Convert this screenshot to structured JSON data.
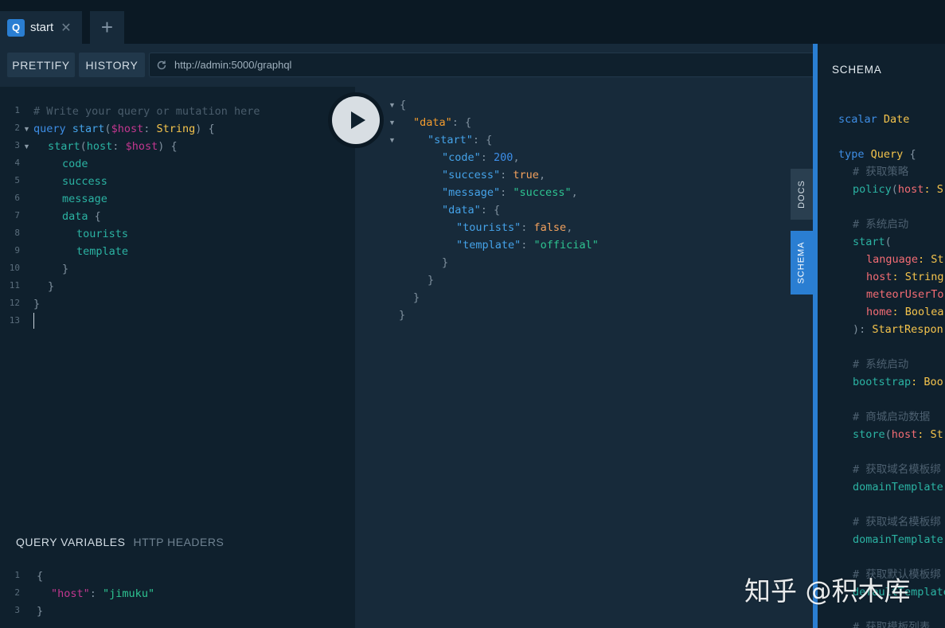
{
  "tabs": [
    {
      "badge": "Q",
      "label": "start",
      "close": "✕"
    }
  ],
  "new_tab": "+",
  "toolbar": {
    "prettify": "PRETTIFY",
    "history": "HISTORY",
    "url": "http://admin:5000/graphql"
  },
  "editor": {
    "line_numbers": [
      "1",
      "2",
      "3",
      "4",
      "5",
      "6",
      "7",
      "8",
      "9",
      "10",
      "11",
      "12",
      "13"
    ],
    "comment": "# Write your query or mutation here",
    "query_kw": "query",
    "op_name": "start",
    "var": "$host",
    "type": "String",
    "field_start": "start",
    "arg_host": "host",
    "fields": [
      "code",
      "success",
      "message",
      "data"
    ],
    "sub_fields": [
      "tourists",
      "template"
    ]
  },
  "variables": {
    "title": "QUERY VARIABLES",
    "headers_tab": "HTTP HEADERS",
    "line_numbers": [
      "1",
      "2",
      "3"
    ],
    "key": "\"host\"",
    "value": "\"jimuku\""
  },
  "result": {
    "data_key": "\"data\"",
    "start_key": "\"start\"",
    "code_key": "\"code\"",
    "code_val": "200",
    "success_key": "\"success\"",
    "success_val": "true",
    "message_key": "\"message\"",
    "message_val": "\"success\"",
    "inner_data_key": "\"data\"",
    "tourists_key": "\"tourists\"",
    "tourists_val": "false",
    "template_key": "\"template\"",
    "template_val": "\"official\""
  },
  "side_tabs": {
    "docs": "DOCS",
    "schema": "SCHEMA"
  },
  "schema": {
    "title": "SCHEMA",
    "lines": [
      {
        "kind": "scalar",
        "a": "scalar",
        "b": "Date"
      },
      {
        "kind": "type",
        "a": "type",
        "b": "Query",
        "c": "{"
      },
      {
        "kind": "comment",
        "a": "# 获取策略"
      },
      {
        "kind": "field",
        "a": "policy",
        "p": "(",
        "arg": "host",
        "c": ": S"
      },
      {
        "kind": "comment",
        "a": "# 系统启动"
      },
      {
        "kind": "field",
        "a": "start",
        "p": "("
      },
      {
        "kind": "arg",
        "arg": "language",
        "c": ": St"
      },
      {
        "kind": "arg",
        "arg": "host",
        "c": ": String"
      },
      {
        "kind": "arg",
        "arg": "meteorUserTo"
      },
      {
        "kind": "arg",
        "arg": "home",
        "c": ": Boolea"
      },
      {
        "kind": "ret",
        "p": "): ",
        "c": "StartRespon"
      },
      {
        "kind": "comment",
        "a": "# 系统启动"
      },
      {
        "kind": "field",
        "a": "bootstrap",
        "c": ": Boo"
      },
      {
        "kind": "comment",
        "a": "# 商城启动数据"
      },
      {
        "kind": "field",
        "a": "store",
        "p": "(",
        "arg": "host",
        "c": ": St"
      },
      {
        "kind": "comment",
        "a": "# 获取域名模板绑"
      },
      {
        "kind": "field",
        "a": "domainTemplate"
      },
      {
        "kind": "comment",
        "a": "# 获取域名模板绑"
      },
      {
        "kind": "field",
        "a": "domainTemplate"
      },
      {
        "kind": "comment",
        "a": "# 获取默认模板绑"
      },
      {
        "kind": "field",
        "a": "defaultTemplate"
      },
      {
        "kind": "comment",
        "a": "# 获取模板列表"
      }
    ]
  },
  "watermark": "知乎 @积木库"
}
